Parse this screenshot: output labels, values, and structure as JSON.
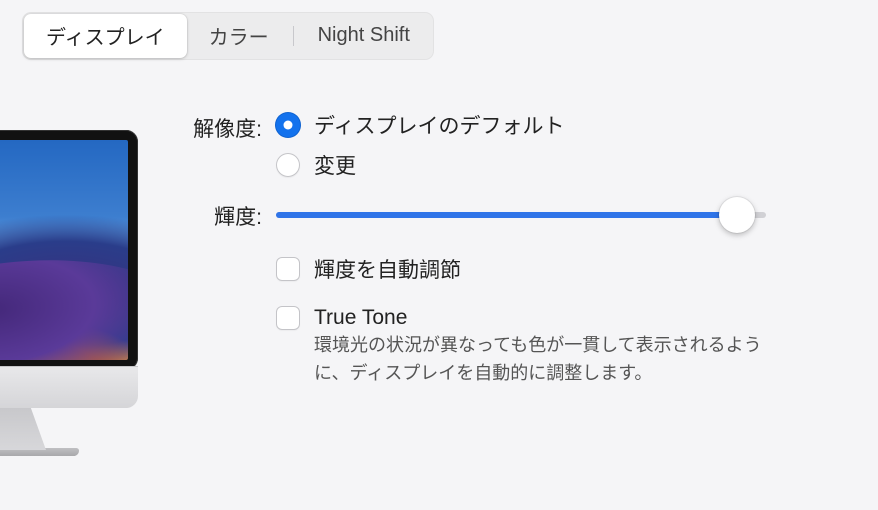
{
  "tabs": {
    "display": "ディスプレイ",
    "color": "カラー",
    "night_shift": "Night Shift"
  },
  "resolution": {
    "label": "解像度:",
    "default_option": "ディスプレイのデフォルト",
    "scaled_option": "変更"
  },
  "brightness": {
    "label": "輝度:"
  },
  "auto_brightness": {
    "label": "輝度を自動調節"
  },
  "true_tone": {
    "label": "True Tone",
    "helper": "環境光の状況が異なっても色が一貫して表示されるように、ディスプレイを自動的に調整します。"
  }
}
